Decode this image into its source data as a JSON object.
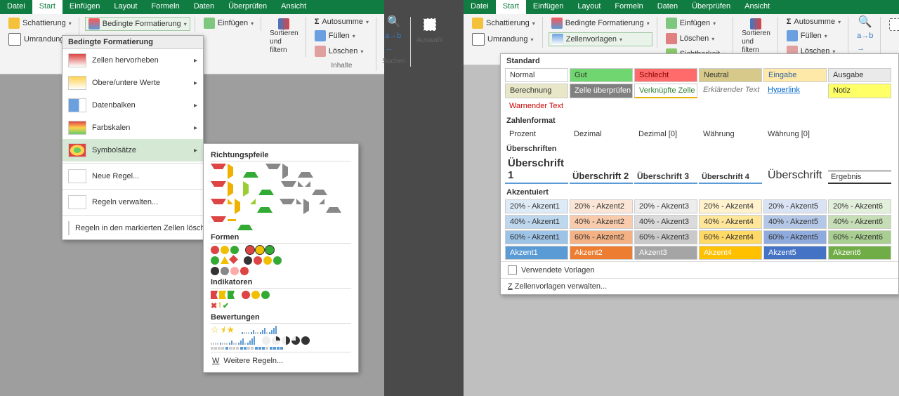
{
  "menubar": [
    "Datei",
    "Start",
    "Einfügen",
    "Layout",
    "Formeln",
    "Daten",
    "Überprüfen",
    "Ansicht"
  ],
  "ribbon": {
    "shading": "Schattierung",
    "border": "Umrandung",
    "condfmt": "Bedingte Formatierung",
    "cellstyles": "Zellenvorlagen",
    "insert": "Einfügen",
    "delete": "Löschen",
    "fill": "Füllen",
    "clear": "Löschen",
    "visibility": "Sichtbarkeit",
    "sort": "Sortieren",
    "filter": "und filtern",
    "autosum": "Autosumme",
    "grp_content": "Inhalte",
    "grp_search": "Suchen",
    "grp_select": "Auswahl"
  },
  "cfmenu": {
    "title": "Bedingte Formatierung",
    "items": [
      "Zellen hervorheben",
      "Obere/untere Werte",
      "Datenbalken",
      "Farbskalen",
      "Symbolsätze"
    ],
    "newrule": "Neue Regel...",
    "manage": "Regeln verwalten...",
    "clear": "Regeln in den markierten Zellen löschen"
  },
  "iconsets": {
    "cat_dir": "Richtungspfeile",
    "cat_shapes": "Formen",
    "cat_ind": "Indikatoren",
    "cat_rate": "Bewertungen",
    "more": "Weitere Regeln..."
  },
  "styles": {
    "sec_std": "Standard",
    "std": [
      "Normal",
      "Gut",
      "Schlecht",
      "Neutral",
      "Eingabe",
      "Ausgabe",
      "Berechnung",
      "Zelle überprüfen",
      "Verknüpfte Zelle",
      "Erklärender Text",
      "Hyperlink",
      "Notiz",
      "Warnender Text"
    ],
    "sec_num": "Zahlenformat",
    "num": [
      "Prozent",
      "Dezimal",
      "Dezimal [0]",
      "Währung",
      "Währung [0]"
    ],
    "sec_head": "Überschriften",
    "head": [
      "Überschrift 1",
      "Überschrift 2",
      "Überschrift 3",
      "Überschrift 4",
      "Überschrift",
      "Ergebnis"
    ],
    "sec_acc": "Akzentuiert",
    "acc_rows": [
      "20% - Akzent",
      "40% - Akzent",
      "60% - Akzent",
      "Akzent"
    ],
    "used": "Verwendete Vorlagen",
    "manage": "Zellenvorlagen verwalten..."
  },
  "colors": {
    "green": "#107c41",
    "good": "#70d670",
    "bad": "#ff6b6b",
    "neutral": "#d6c98a",
    "input": "#ffe9a8",
    "inputtxt": "#2b5fa3",
    "output": "#eaeaea",
    "calc": "#e8e8c8",
    "check": "#808080",
    "link": "#0066cc",
    "note": "#ffff66",
    "acc": [
      "#5b9bd5",
      "#ed7d31",
      "#a5a5a5",
      "#ffc000",
      "#4472c4",
      "#70ad47"
    ]
  }
}
